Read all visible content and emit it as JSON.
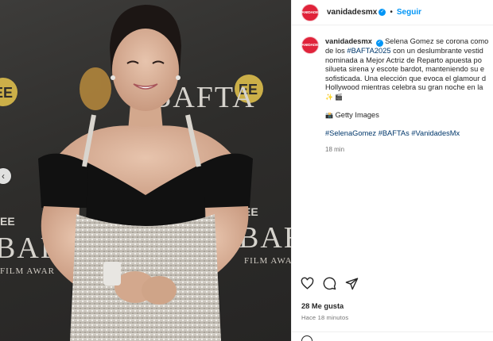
{
  "post": {
    "username": "vanidadesmx",
    "avatar_text": "VANIDADES",
    "follow_label": "Seguir",
    "separator": "•",
    "caption_lines": [
      "Selena Gomez se corona como",
      "de los ",
      "nominada a Mejor Actriz de Reparto apuesta po",
      "silueta sirena y escote bardot, manteniendo su e",
      "sofisticada. Una elección que evoca el glamour d",
      "Hollywood mientras celebra su gran noche en la"
    ],
    "caption_hashtag_inline": "#BAFTA2025",
    "caption_line2_rest": " con un deslumbrante vestid",
    "caption_end_emojis": "✨ 🎬",
    "credit_emoji": "📸",
    "credit_text": "Getty Images",
    "hashtags": [
      "#SelenaGomez",
      "#BAFTAs",
      "#VanidadesMx"
    ],
    "caption_time": "18 min",
    "likes": "28 Me gusta",
    "time_ago": "Hace 18 minutos"
  },
  "photo": {
    "backdrop_text_top": "BAFTA",
    "backdrop_text_bottom": "BAFTA",
    "backdrop_subtitle": "FILM AWARDS",
    "sponsor": "EE",
    "gown_colors": {
      "velvet": "#111111",
      "sequin": "#c9c4bc"
    }
  },
  "icons": [
    "verified-badge-icon",
    "heart-icon",
    "comment-icon",
    "share-icon",
    "chevron-left-icon",
    "emoji-icon"
  ]
}
